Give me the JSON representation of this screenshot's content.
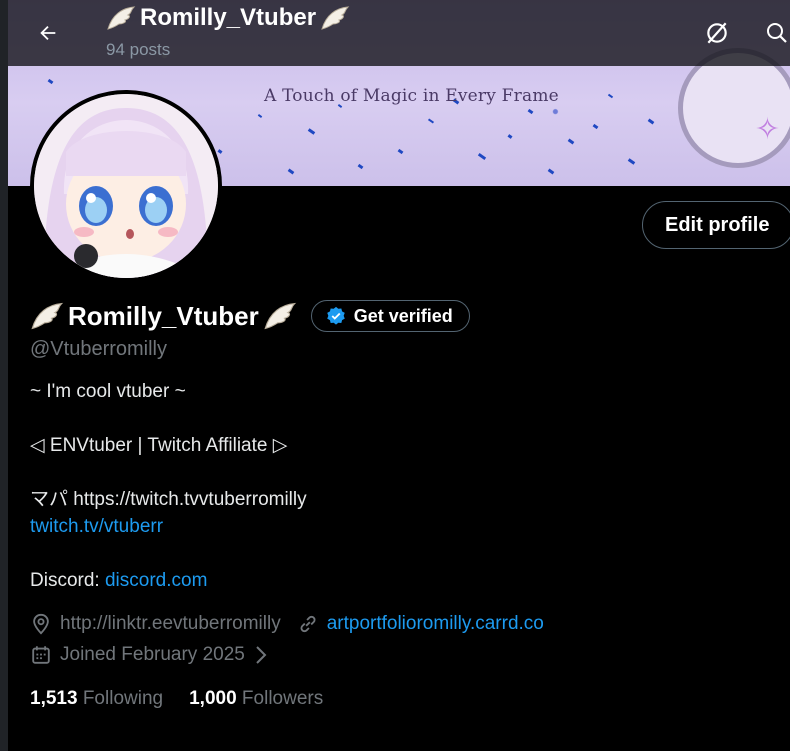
{
  "header": {
    "title": "Romilly_Vtuber",
    "posts_count": "94 posts"
  },
  "banner": {
    "tagline": "A Touch of Magic in Every Frame"
  },
  "profile": {
    "display_name": "Romilly_Vtuber",
    "handle": "@Vtuberromilly",
    "edit_profile_label": "Edit profile",
    "get_verified_label": "Get verified",
    "bio": {
      "line1": "~ I'm cool vtuber ~",
      "line2": "◁ ENVtuber | Twitch Affiliate ▷",
      "line3": "マパ  https://twitch.tvvtuberromilly",
      "line4_link": "twitch.tv/vtuberr",
      "line5_prefix": "Discord: ",
      "line5_link": "discord.com"
    },
    "location": "http://linktr.eevtuberromilly",
    "website": "artportfolioromilly.carrd.co",
    "joined": "Joined February 2025",
    "following_count": "1,513",
    "following_label": "Following",
    "followers_count": "1,000",
    "followers_label": "Followers"
  },
  "colors": {
    "accent": "#1d9bf0",
    "muted": "#71767b",
    "verified_badge": "#1d9bf0"
  },
  "icons": [
    "back-arrow-icon",
    "grok-icon",
    "search-icon",
    "wing-icon",
    "verified-badge-icon",
    "location-icon",
    "link-icon",
    "calendar-icon",
    "chevron-right-icon"
  ]
}
